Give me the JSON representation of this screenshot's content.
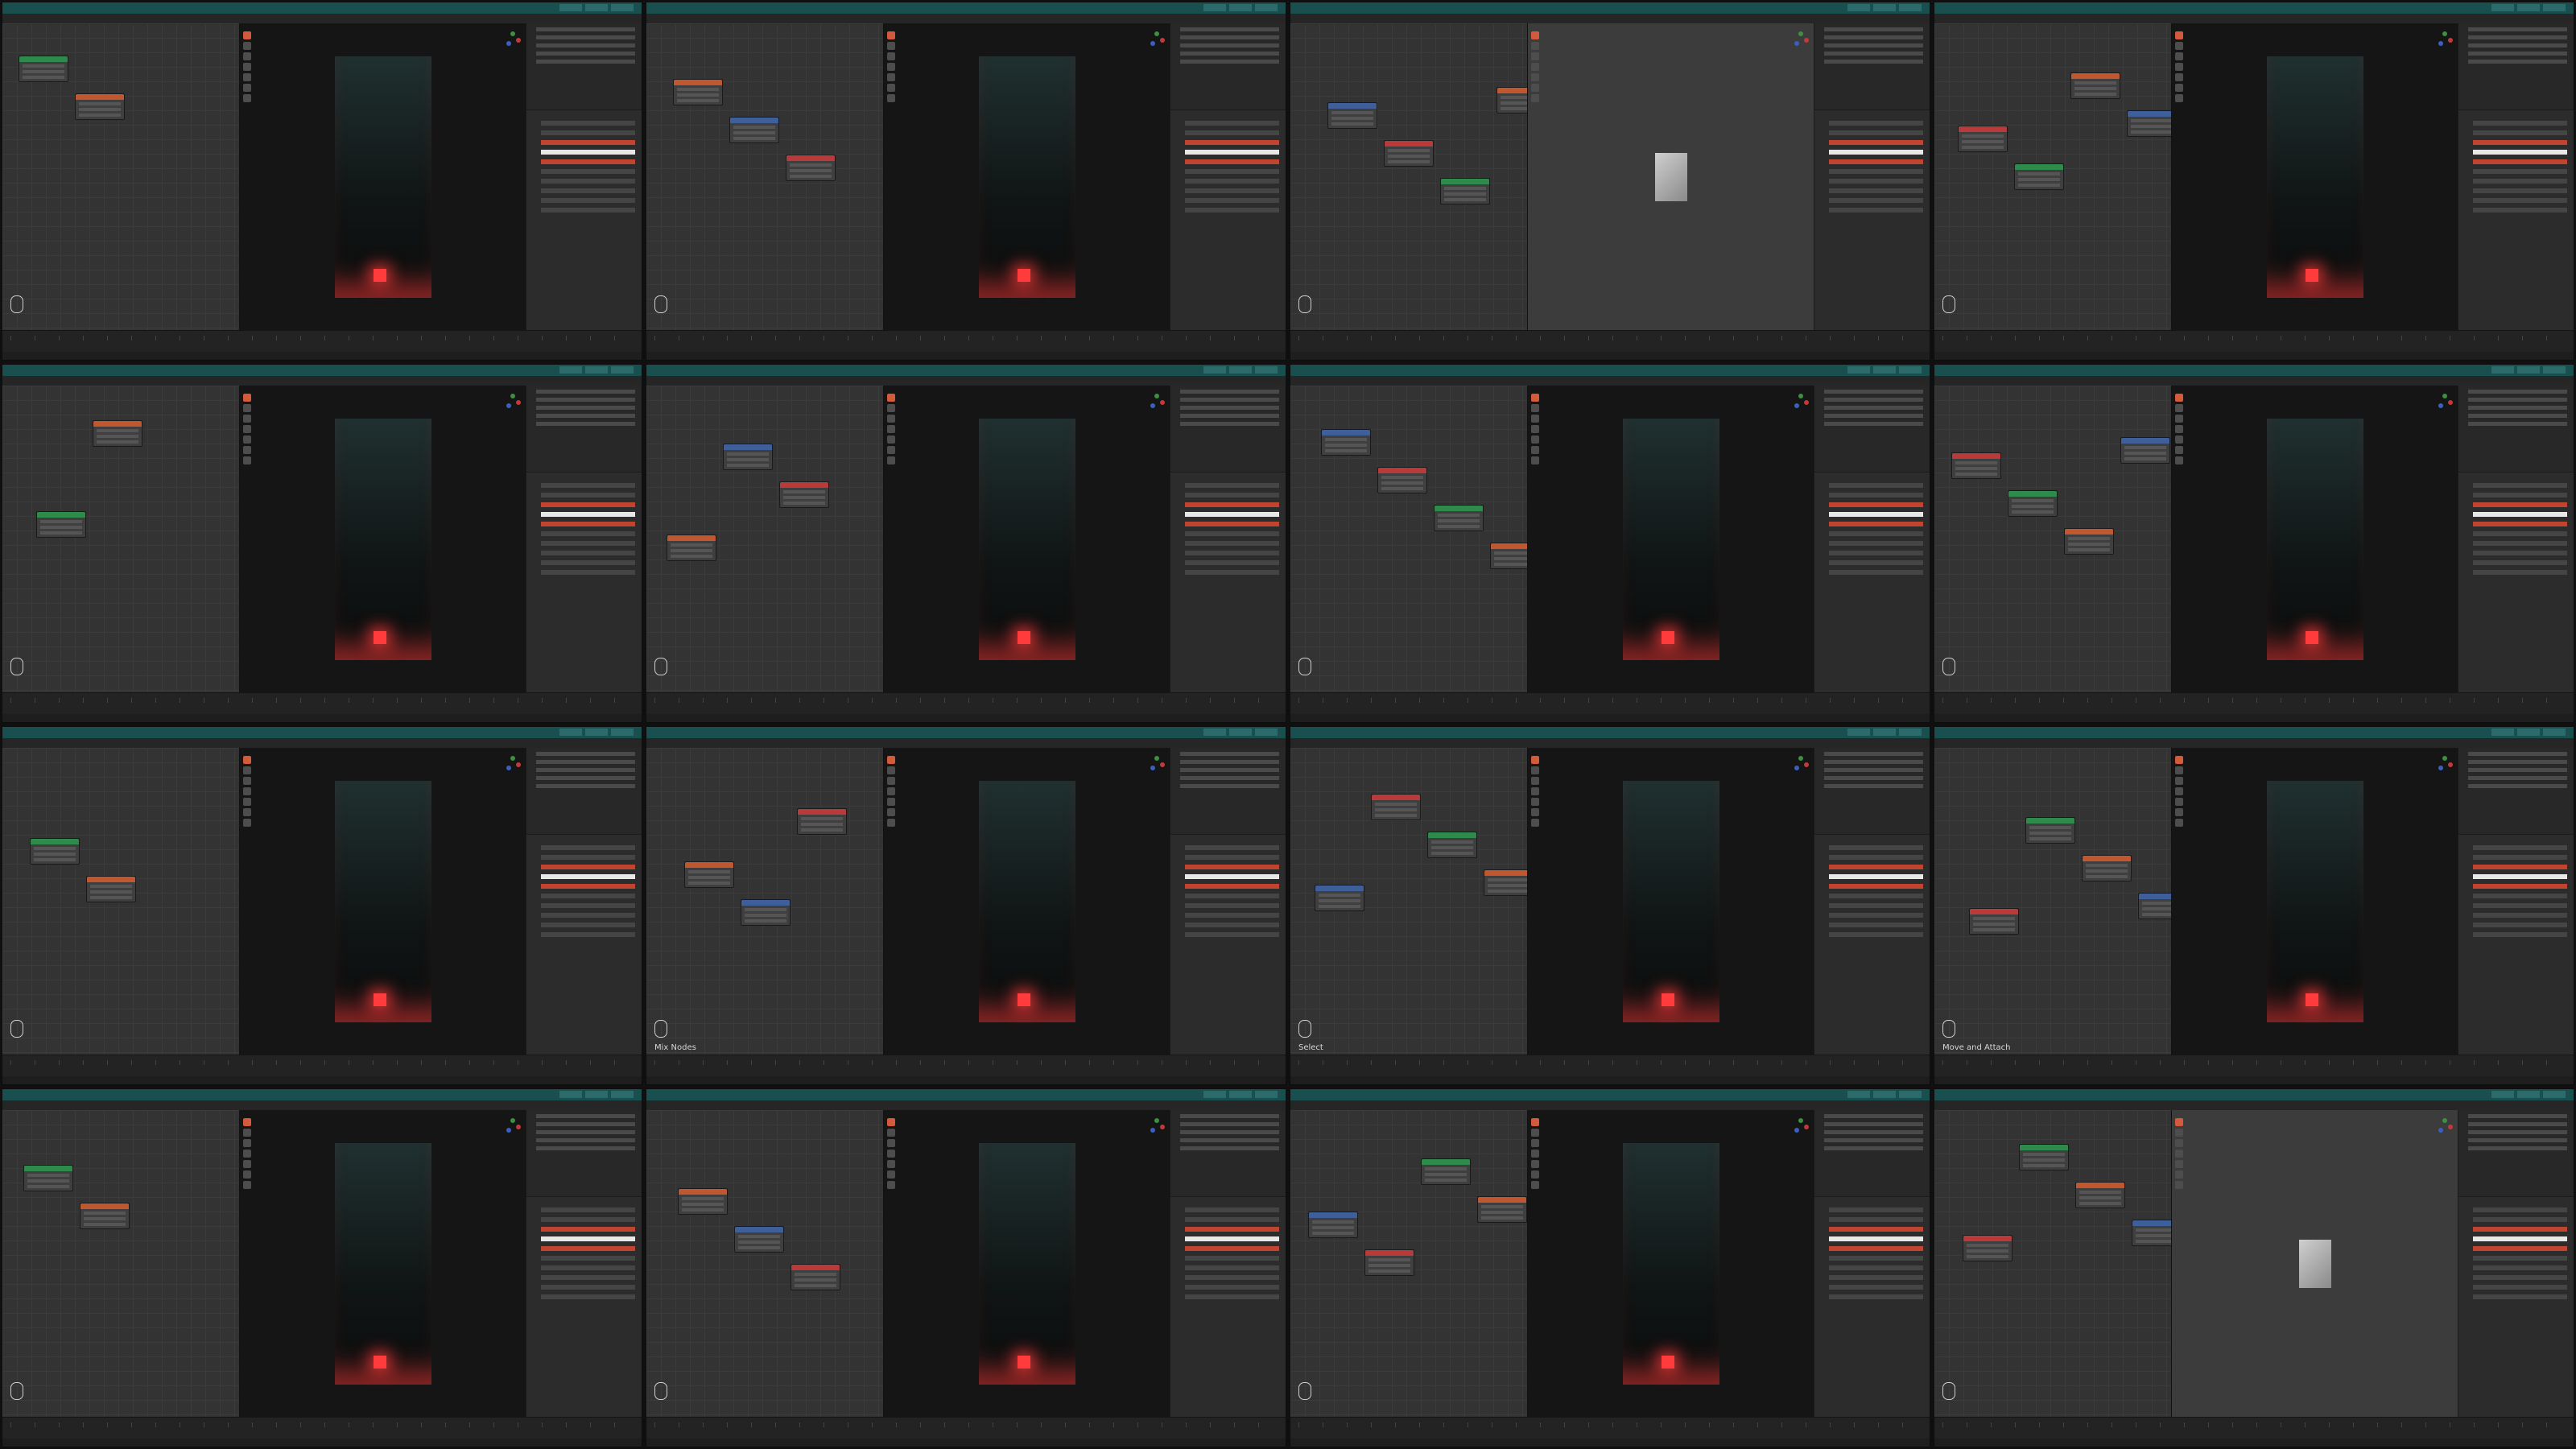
{
  "tiles": [
    {
      "caption": "",
      "view": "render"
    },
    {
      "caption": "",
      "view": "render"
    },
    {
      "caption": "",
      "view": "solid"
    },
    {
      "caption": "",
      "view": "render"
    },
    {
      "caption": "",
      "view": "render"
    },
    {
      "caption": "",
      "view": "render"
    },
    {
      "caption": "",
      "view": "render"
    },
    {
      "caption": "",
      "view": "render"
    },
    {
      "caption": "",
      "view": "render"
    },
    {
      "caption": "Mix Nodes",
      "view": "render"
    },
    {
      "caption": "Select",
      "view": "render"
    },
    {
      "caption": "Move and Attach",
      "view": "render"
    },
    {
      "caption": "",
      "view": "render"
    },
    {
      "caption": "",
      "view": "render"
    },
    {
      "caption": "",
      "view": "render"
    },
    {
      "caption": "",
      "view": "solid"
    }
  ],
  "colors": {
    "accent_orange": "#d35a3a",
    "glow_red": "#ff3b3b",
    "node_green": "#2f8b4b",
    "node_orange": "#c1572f",
    "header_teal": "#1a4f4f"
  },
  "icons": [
    "mouse-icon",
    "gizmo-icon",
    "tool-icon"
  ]
}
